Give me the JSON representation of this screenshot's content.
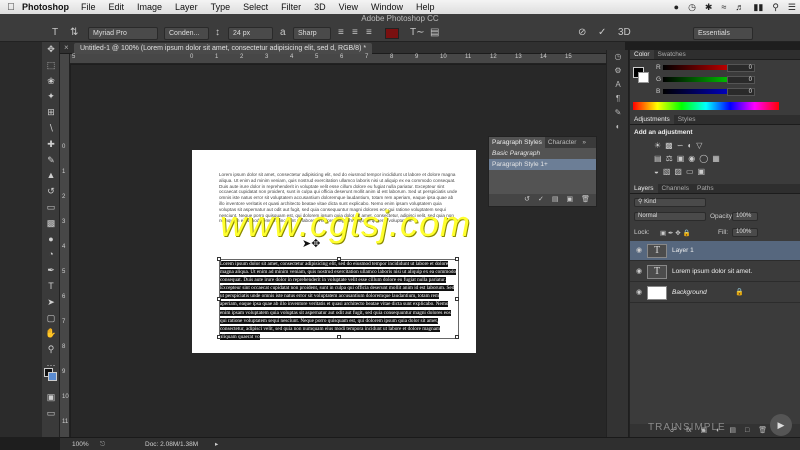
{
  "menubar": {
    "app": "Photoshop",
    "items": [
      "File",
      "Edit",
      "Image",
      "Layer",
      "Type",
      "Select",
      "Filter",
      "3D",
      "View",
      "Window",
      "Help"
    ]
  },
  "window": {
    "title": "Adobe Photoshop CC"
  },
  "options": {
    "font_family": "Myriad Pro",
    "font_style": "Conden...",
    "font_size": "24 px",
    "antialias": "Sharp",
    "workspace": "Essentials",
    "threed_label": "3D"
  },
  "document": {
    "tab_title": "Untitled-1 @ 100% (Lorem ipsum dolor sit amet, consectetur adipisicing elit, sed d, RGB/8) *",
    "ruler_h": [
      "5",
      "0",
      "1",
      "2",
      "3",
      "4",
      "5",
      "6",
      "7",
      "8",
      "9",
      "10",
      "11",
      "12",
      "13",
      "14",
      "15"
    ],
    "ruler_v": [
      "0",
      "1",
      "2",
      "3",
      "4",
      "5",
      "6",
      "7",
      "8",
      "9",
      "10",
      "11"
    ],
    "para1": "Lorem ipsum dolor sit amet, consectetur adipisicing elit, sed do eiusmod tempor incididunt ut labore et dolore magna aliqua. Ut enim ad minim veniam, quis nostrud exercitation ullamco laboris nisi ut aliquip ex ea commodo consequat. Duis aute irure dolor in reprehenderit in voluptate velit esse cillum dolore eu fugiat nulla pariatur. Excepteur sint occaecat cupidatat non proident, sunt in culpa qui officia deserunt mollit anim id est laborum. Sed ut perspiciatis unde omnis iste natus error sit voluptatem accusantium doloremque laudantium, totam rem aperiam, eaque ipsa quae ab illo inventore veritatis et quasi architecto beatae vitae dicta sunt explicabo. Nemo enim ipsam voluptatem quia voluptas sit aspernatur aut odit aut fugit, sed quia consequuntur magni dolores eos qui ratione voluptatem sequi nesciunt. Neque porro quisquam est, qui dolorem ipsum quia dolor sit amet, consectetur, adipisci velit, sed quia non numquam eius modi tempora incidunt ut labore et dolore magnam aliquam quaerat voluptatem.",
    "para2": "Lorem ipsum dolor sit amet, consectetur adipisicing elit, sed do eiusmod tempor incididunt ut labore et dolore magna aliqua. Ut enim ad minim veniam, quis nostrud exercitation ullamco laboris nisi ut aliquip ex ea commodo consequat. Duis aute irure dolor in reprehenderit in voluptate velit esse cillum dolore eu fugiat nulla pariatur. Excepteur sint occaecat cupidatat non proident, sunt in culpa qui officia deserunt mollit anim id est laborum. Sed ut perspiciatis unde omnis iste natus error sit voluptatem accusantium doloremque laudantium, totam rem aperiam, eaque ipsa quae ab illo inventore veritatis et quasi architecto beatae vitae dicta sunt explicabo. Nemo enim ipsam voluptatem quia voluptas sit aspernatur aut odit aut fugit, sed quia consequuntur magni dolores eos qui ratione voluptatem sequi nesciunt. Neque porro quisquam est, qui dolorem ipsum quia dolor sit amet, consectetur, adipisci velit, sed quia non numquam eius modi tempora incidunt ut labore et dolore magnam aliquam quaerat vo",
    "watermark": "www.cgtsj.com"
  },
  "paragraph_styles": {
    "tabs": [
      "Paragraph Styles",
      "Character"
    ],
    "items": [
      "Basic Paragraph",
      "Paragraph Style 1+"
    ],
    "selected": "Paragraph Style 1+"
  },
  "color_panel": {
    "tabs": [
      "Color",
      "Swatches"
    ],
    "labels": [
      "R",
      "G",
      "B"
    ],
    "values": [
      "0",
      "0",
      "0"
    ],
    "fg_color": "#000000",
    "bg_color": "#ffffff"
  },
  "adjustments": {
    "tabs": [
      "Adjustments",
      "Styles"
    ],
    "add_label": "Add an adjustment"
  },
  "layers": {
    "tabs": [
      "Layers",
      "Channels",
      "Paths"
    ],
    "kind_label": "Kind",
    "blend_mode": "Normal",
    "opacity_label": "Opacity:",
    "opacity": "100%",
    "lock_label": "Lock:",
    "fill_label": "Fill:",
    "fill": "100%",
    "items": [
      {
        "name": "Layer 1",
        "thumb": "T",
        "selected": true
      },
      {
        "name": "Lorem ipsum dolor sit amet...",
        "thumb": "T",
        "selected": false
      },
      {
        "name": "Background",
        "thumb": "",
        "selected": false
      }
    ]
  },
  "status": {
    "zoom": "100%",
    "doc_info": "Doc: 2.08M/1.38M"
  },
  "brand": "TRAINSIMPLE"
}
